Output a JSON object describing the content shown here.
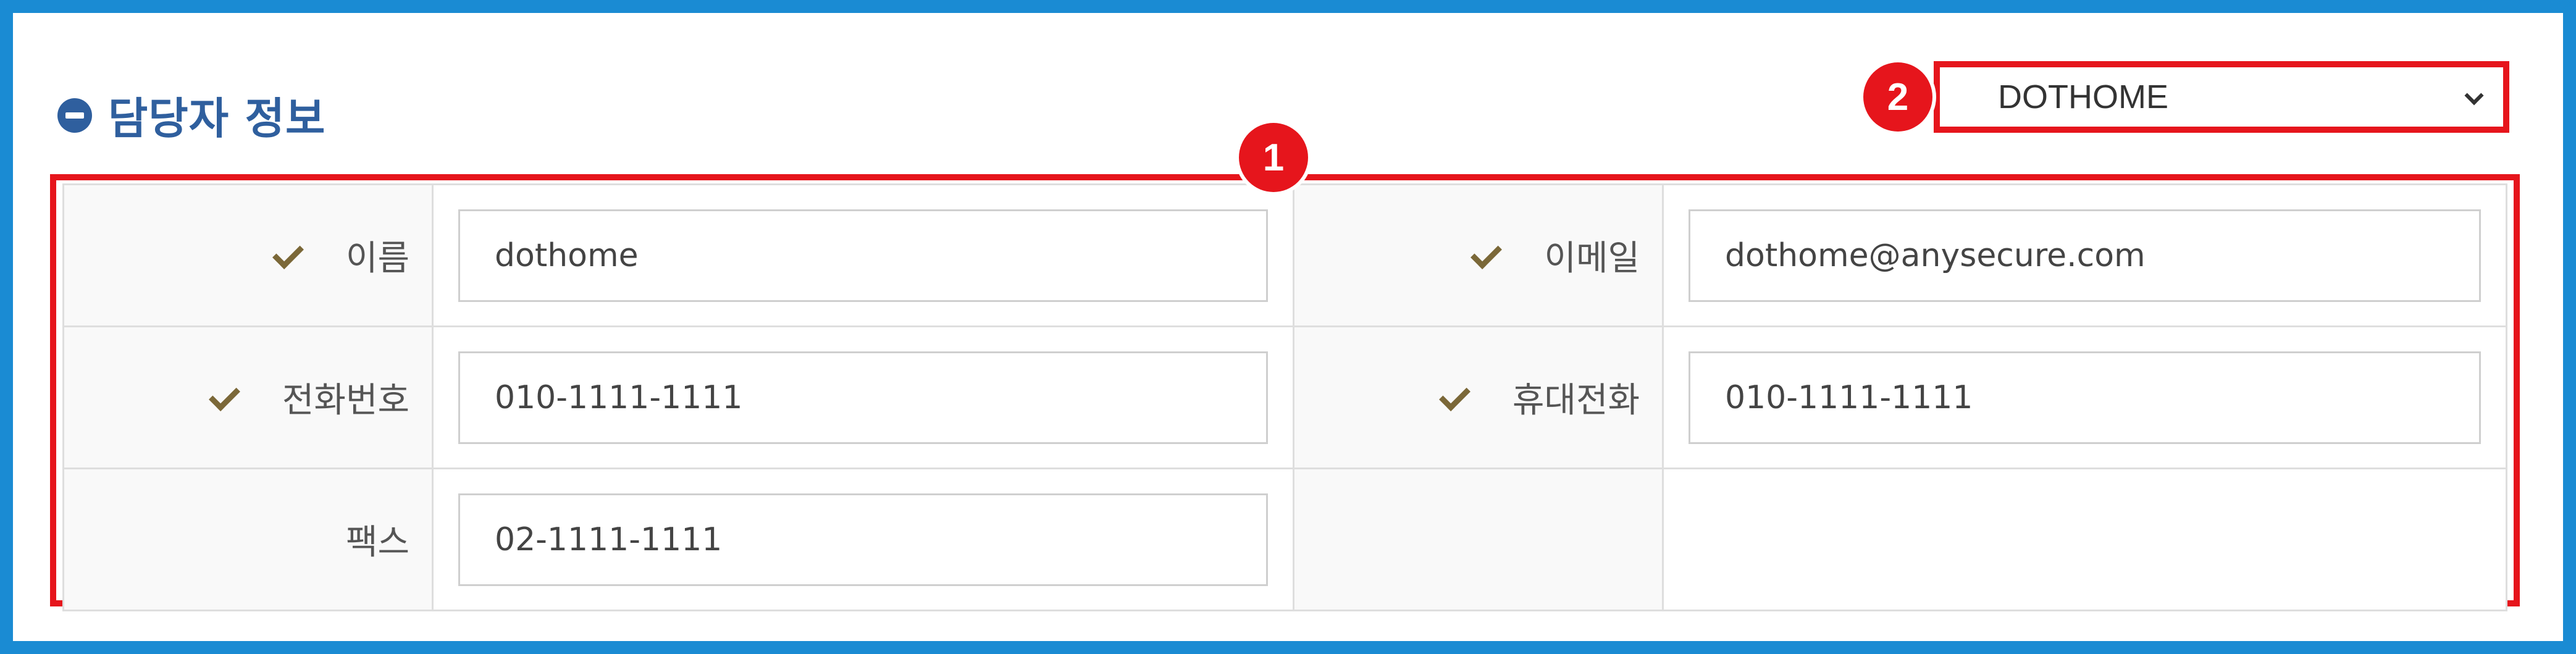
{
  "section": {
    "title": "담당자 정보"
  },
  "selector": {
    "value": "DOTHOME"
  },
  "badges": {
    "one": "1",
    "two": "2"
  },
  "fields": {
    "name": {
      "label": "이름",
      "value": "dothome"
    },
    "email": {
      "label": "이메일",
      "value": "dothome@anysecure.com"
    },
    "phone": {
      "label": "전화번호",
      "value": "010-1111-1111"
    },
    "mobile": {
      "label": "휴대전화",
      "value": "010-1111-1111"
    },
    "fax": {
      "label": "팩스",
      "value": "02-1111-1111"
    }
  },
  "colors": {
    "frame": "#1a8bd3",
    "annotation": "#e6151c",
    "title": "#2f5f9e",
    "check": "#7b6838"
  },
  "icons": {
    "section": "minus-circle-icon",
    "required": "check-icon",
    "dropdown": "chevron-down-icon"
  }
}
